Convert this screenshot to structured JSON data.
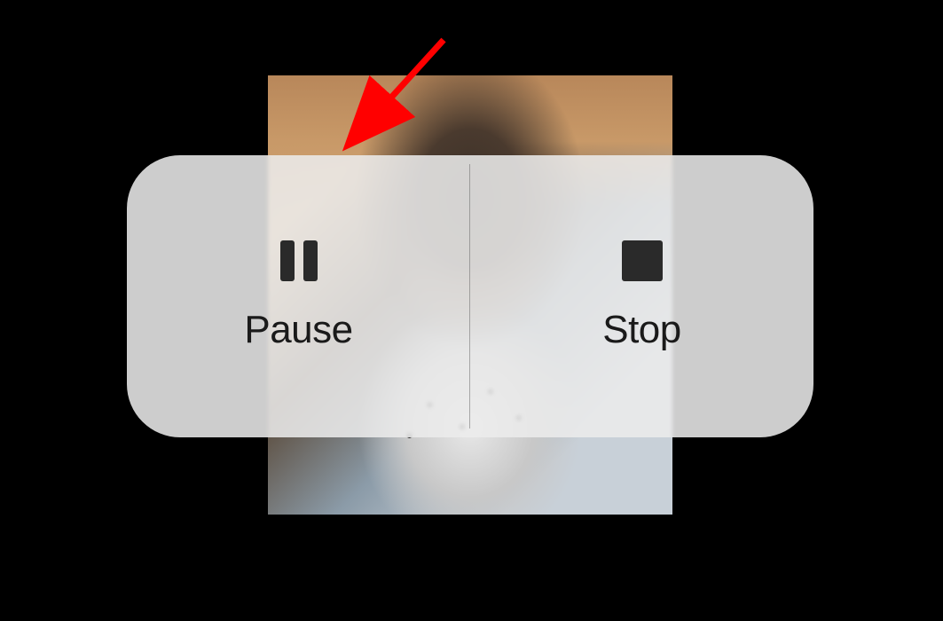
{
  "controls": {
    "pause": {
      "label": "Pause",
      "icon": "pause-icon"
    },
    "stop": {
      "label": "Stop",
      "icon": "stop-icon"
    }
  },
  "annotation": {
    "type": "arrow",
    "color": "#ff0000",
    "target": "pause-button"
  }
}
